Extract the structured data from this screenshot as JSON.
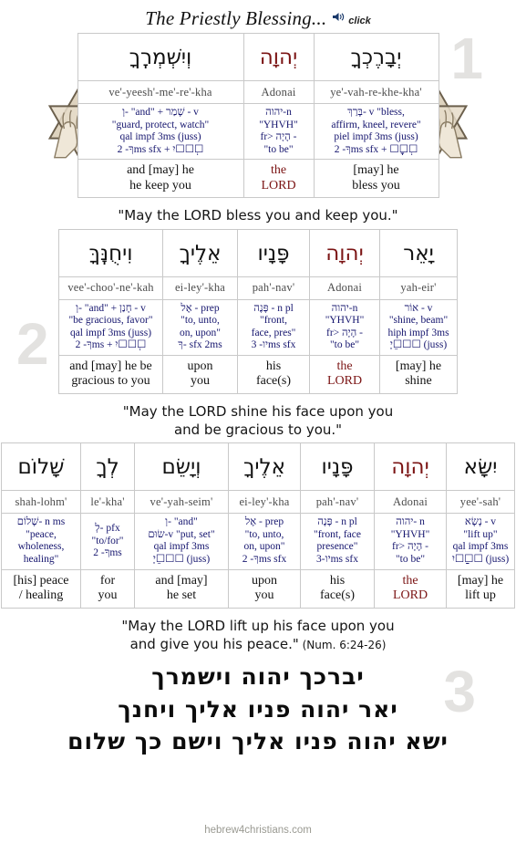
{
  "header": {
    "title": "The Priestly Blessing...",
    "audio_hint": "click",
    "speaker_icon": "speaker-icon"
  },
  "colors": {
    "divine_name": "#7b1414",
    "parse_text": "#15156e",
    "ghost_number": "#e3e2e0",
    "grid_line": "#c9c9c9"
  },
  "blocks": [
    {
      "number": "1",
      "columns": [
        {
          "hebrew": "וְיִשְׁמְרֶֽךָ",
          "is_divine": false,
          "translit": "ve'-yeesh'-me'-re'-kha",
          "translit_bold": "yeesh'-me'-re'-",
          "parse": [
            "וְ- \"and\" + שָׁמַר - v",
            "\"guard, protect, watch\"",
            "qal impf 3ms (juss)",
            "ךָ- 2ms sfx + יִ☐☐☐ְ"
          ],
          "english": [
            "and [may] he",
            "he keep you"
          ],
          "english_is_lord": false
        },
        {
          "hebrew": "יְהוָה",
          "is_divine": true,
          "translit": "Adonai",
          "parse": [
            "יהוה-n",
            "\"YHVH\"",
            "fr> הָיָה -",
            "\"to be\""
          ],
          "english": [
            "the",
            "LORD"
          ],
          "english_is_lord": true
        },
        {
          "hebrew": "יְבָרֶכְךָ",
          "is_divine": false,
          "translit": "ye'-vah-re-khe-kha'",
          "parse": [
            "בָּרַךְ- v \"bless,",
            "affirm, kneel, revere\"",
            "piel impf 3ms (juss)",
            "ךָ- 2ms sfx + ☐ֶ☐ָ☐ְ"
          ],
          "english": [
            "[may] he",
            "bless you"
          ],
          "english_is_lord": false
        }
      ],
      "sentence": [
        "\"May the LORD bless you and keep you.\""
      ]
    },
    {
      "number": "2",
      "columns": [
        {
          "hebrew": "וִיחֻנֶּֽךָּ",
          "is_divine": false,
          "translit": "vee'-choo'-ne'-kah",
          "parse": [
            "וְ- \"and\" + חָנַן - v",
            "\"be gracious, favor\"",
            "qal impf 3ms (juss)",
            "ךָ- 2ms + יִ☐☐☐ְ"
          ],
          "english": [
            "and [may] he be",
            "gracious to you"
          ],
          "english_is_lord": false
        },
        {
          "hebrew": "אֵלֶיךָ",
          "is_divine": false,
          "translit": "ei-ley'-kha",
          "parse": [
            "אֶל - prep",
            "\"to, unto,",
            "on, upon\"",
            "ךָ- sfx 2ms"
          ],
          "english": [
            "upon",
            "you"
          ],
          "english_is_lord": false
        },
        {
          "hebrew": "פָּנָיו",
          "is_divine": false,
          "translit": "pah'-nav'",
          "parse": [
            "פָּנֶה - n pl",
            "\"front,",
            "face, pres\"",
            "יו- 3ms sfx"
          ],
          "english": [
            "his",
            "face(s)"
          ],
          "english_is_lord": false
        },
        {
          "hebrew": "יְהוָה",
          "is_divine": true,
          "translit": "Adonai",
          "parse": [
            "יהוה-n",
            "\"YHVH\"",
            "fr> הָיָה -",
            "\"to be\""
          ],
          "english": [
            "the",
            "LORD"
          ],
          "english_is_lord": true
        },
        {
          "hebrew": "יָאֵר",
          "is_divine": false,
          "translit": "yah-eir'",
          "parse": [
            "אוֹר - v",
            "\"shine, beam\"",
            "hiph impf 3ms",
            "יָ☐ֵ☐☐ (juss)"
          ],
          "english": [
            "[may] he",
            "shine"
          ],
          "english_is_lord": false
        }
      ],
      "sentence": [
        "\"May the LORD shine his face upon you",
        "and be gracious to you.\""
      ]
    },
    {
      "number": "3",
      "columns": [
        {
          "hebrew": "שָׁלוֹם",
          "is_divine": false,
          "translit": "shah-lohm'",
          "parse": [
            "שָׁלוֹם- n ms",
            "\"peace,",
            "wholeness,",
            "healing\""
          ],
          "english": [
            "[his] peace",
            "/ healing"
          ],
          "english_is_lord": false
        },
        {
          "hebrew": "לְךָ",
          "is_divine": false,
          "translit": "le'-kha'",
          "parse": [
            "לְ- pfx",
            "\"to/for\"",
            "ךָ- 2ms"
          ],
          "english": [
            "for",
            "you"
          ],
          "english_is_lord": false
        },
        {
          "hebrew": "וְיָשֵׂם",
          "is_divine": false,
          "translit": "ve'-yah-seim'",
          "parse": [
            "וְ- \"and\"",
            "שׂוּם-v \"put, set\"",
            "qal impf 3ms",
            "יָ☐ֵ☐☐ (juss)"
          ],
          "english": [
            "and [may]",
            "he set"
          ],
          "english_is_lord": false
        },
        {
          "hebrew": "אֵלֶיךָ",
          "is_divine": false,
          "translit": "ei-ley'-kha",
          "parse": [
            "אֶל - prep",
            "\"to, unto,",
            "on, upon\"",
            "ךָ- 2ms sfx"
          ],
          "english": [
            "upon",
            "you"
          ],
          "english_is_lord": false
        },
        {
          "hebrew": "פָּנָיו",
          "is_divine": false,
          "translit": "pah'-nav'",
          "parse": [
            "פָּנֶה - n pl",
            "\"front, face",
            "presence\"",
            "יו-3ms sfx"
          ],
          "english": [
            "his",
            "face(s)"
          ],
          "english_is_lord": false
        },
        {
          "hebrew": "יְהוָה",
          "is_divine": true,
          "translit": "Adonai",
          "parse": [
            "יהוה- n",
            "\"YHVH\"",
            "fr> הָיָה -",
            "\"to be\""
          ],
          "english": [
            "the",
            "LORD"
          ],
          "english_is_lord": true
        },
        {
          "hebrew": "יִשָּׂא",
          "is_divine": false,
          "translit": "yee'-sah'",
          "parse": [
            "נָשָׂא - v",
            "\"lift up\"",
            "qal impf 3ms",
            "יִ☐☐ַ☐ (juss)"
          ],
          "english": [
            "[may] he",
            "lift up"
          ],
          "english_is_lord": false
        }
      ],
      "sentence": [
        "\"May the LORD lift up his face upon you",
        "and give you his peace.\""
      ],
      "sentence_ref": "(Num. 6:24-26)"
    }
  ],
  "hebrew_block": [
    "יברכך יהוה וישמרך",
    "יאר יהוה פניו אליך ויחנך",
    "ישא יהוה פניו אליך וישם כך שלום"
  ],
  "footer": {
    "site": "hebrew4christians.com"
  },
  "decorations": {
    "left_star": "star-of-david-priestly-hands",
    "right_star": "star-of-david-priestly-hands"
  }
}
